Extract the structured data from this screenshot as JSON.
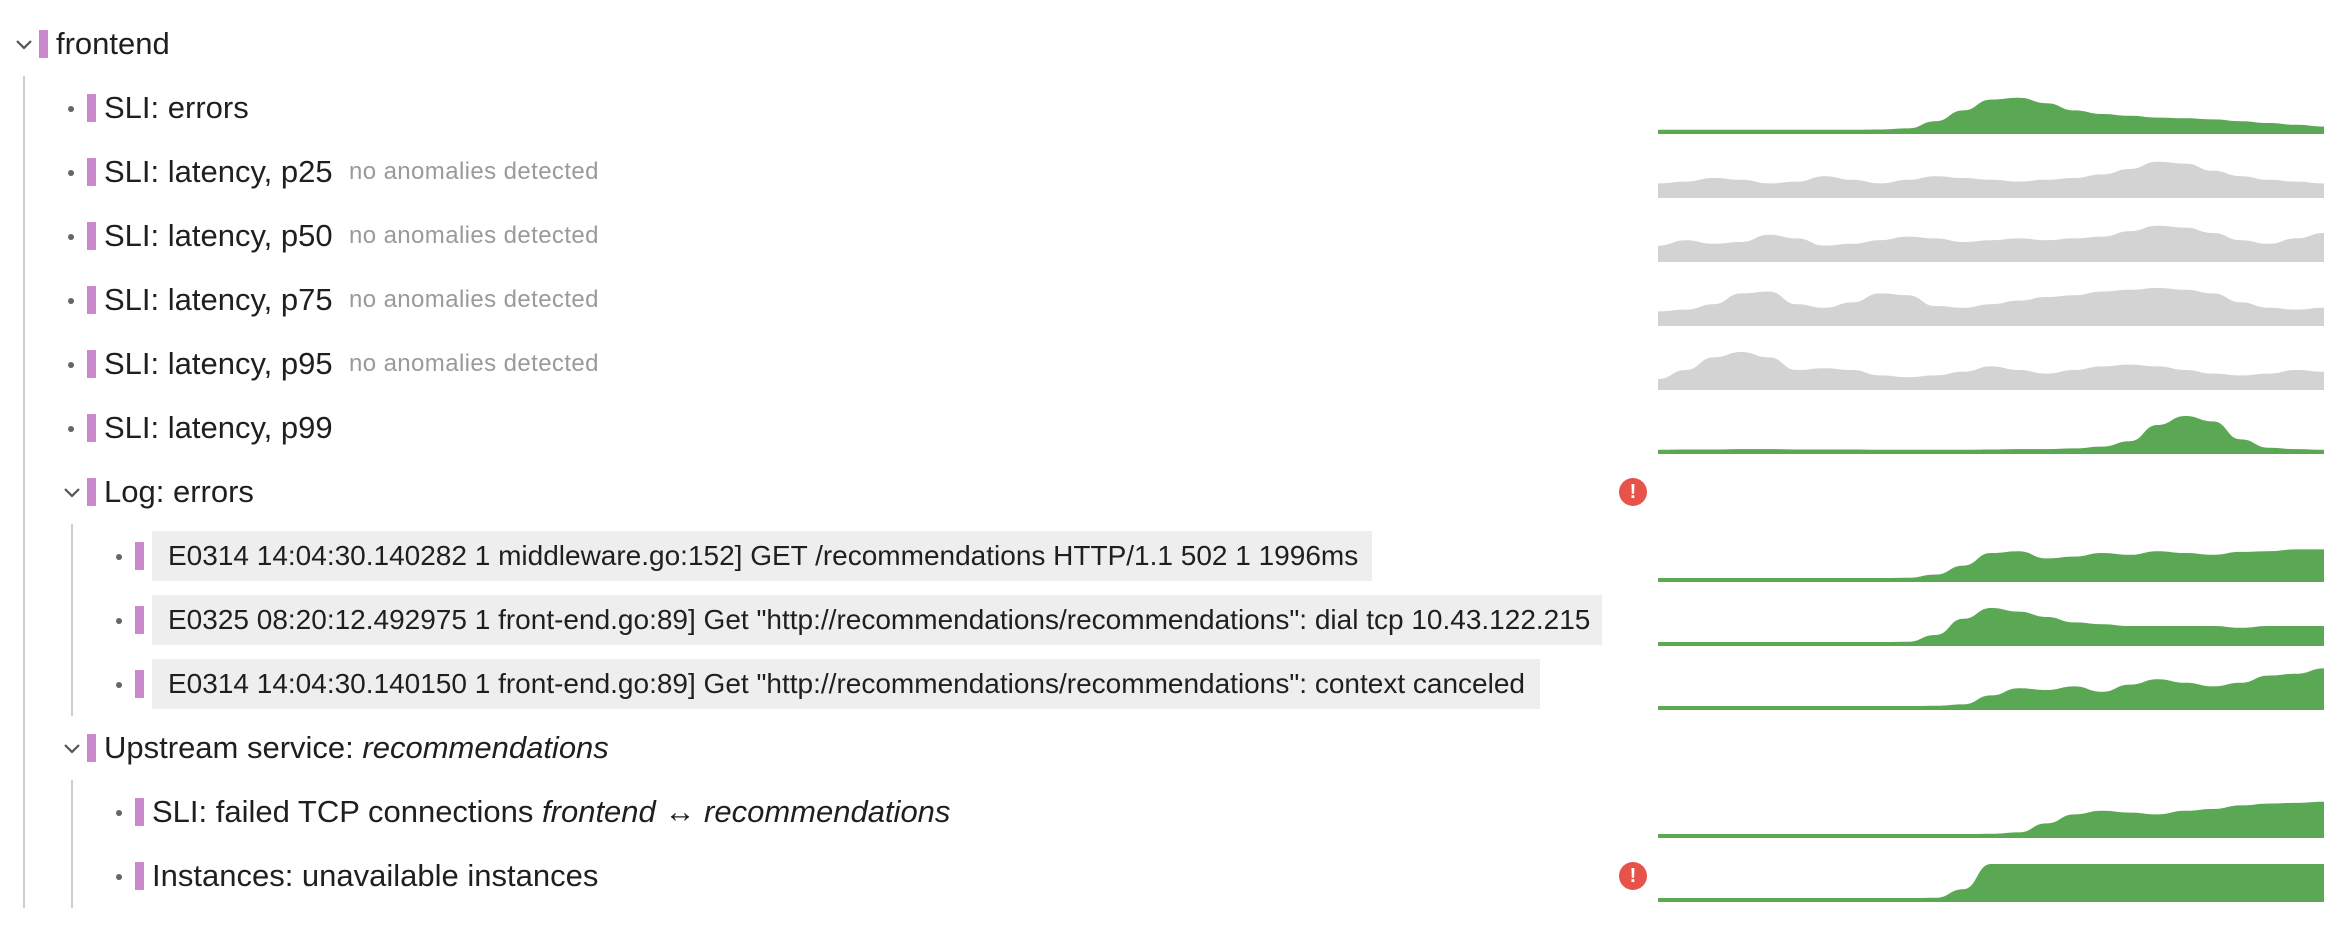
{
  "root": {
    "label": "frontend"
  },
  "rows": [
    {
      "label": "SLI: errors",
      "note": ""
    },
    {
      "label": "SLI: latency, p25",
      "note": "no anomalies detected"
    },
    {
      "label": "SLI: latency, p50",
      "note": "no anomalies detected"
    },
    {
      "label": "SLI: latency, p75",
      "note": "no anomalies detected"
    },
    {
      "label": "SLI: latency, p95",
      "note": "no anomalies detected"
    },
    {
      "label": "SLI: latency, p99",
      "note": ""
    }
  ],
  "log_group": {
    "label": "Log: errors",
    "status": "!",
    "entries": [
      "E0314 14:04:30.140282 1 middleware.go:152] GET /recommendations HTTP/1.1 502 1 1996ms",
      "E0325 08:20:12.492975 1 front-end.go:89] Get \"http://recommendations/recommendations\": dial tcp 10.43.122.215",
      "E0314 14:04:30.140150 1 front-end.go:89] Get \"http://recommendations/recommendations\": context canceled"
    ]
  },
  "upstream": {
    "prefix": "Upstream service: ",
    "service": "recommendations",
    "children": {
      "tcp": {
        "prefix": "SLI: failed TCP connections ",
        "from": "frontend",
        "arrow": " ↔ ",
        "to": "recommendations"
      },
      "instances": {
        "label": "Instances: unavailable instances",
        "status": "!"
      }
    }
  },
  "colors": {
    "anomaly": "#5aa854",
    "normal": "#d3d3d3",
    "marker": "#cc88cc",
    "alert": "#e5534b",
    "log_bg": "#eeeeee"
  },
  "icons": {
    "expand": "chevron-down-icon",
    "alert": "exclamation-circle-icon",
    "bullet": "bullet-icon"
  },
  "sparklines": [
    {
      "kind": "anomaly",
      "values": [
        0.06,
        0.06,
        0.06,
        0.06,
        0.06,
        0.06,
        0.06,
        0.06,
        0.07,
        0.1,
        0.3,
        0.6,
        0.9,
        0.95,
        0.8,
        0.6,
        0.5,
        0.45,
        0.4,
        0.38,
        0.35,
        0.3,
        0.25,
        0.2,
        0.15
      ]
    },
    {
      "kind": "normal",
      "values": [
        0.35,
        0.4,
        0.5,
        0.45,
        0.35,
        0.4,
        0.55,
        0.45,
        0.35,
        0.45,
        0.55,
        0.5,
        0.45,
        0.4,
        0.45,
        0.5,
        0.6,
        0.75,
        0.95,
        0.9,
        0.7,
        0.55,
        0.45,
        0.4,
        0.35
      ]
    },
    {
      "kind": "normal",
      "values": [
        0.4,
        0.55,
        0.45,
        0.5,
        0.7,
        0.6,
        0.4,
        0.45,
        0.55,
        0.65,
        0.6,
        0.5,
        0.55,
        0.6,
        0.55,
        0.6,
        0.65,
        0.8,
        0.95,
        0.9,
        0.75,
        0.55,
        0.45,
        0.6,
        0.75
      ]
    },
    {
      "kind": "normal",
      "values": [
        0.35,
        0.4,
        0.55,
        0.85,
        0.9,
        0.55,
        0.45,
        0.6,
        0.85,
        0.8,
        0.5,
        0.45,
        0.55,
        0.65,
        0.75,
        0.8,
        0.9,
        0.95,
        1.0,
        0.95,
        0.85,
        0.6,
        0.45,
        0.4,
        0.45
      ]
    },
    {
      "kind": "normal",
      "values": [
        0.25,
        0.5,
        0.85,
        1.0,
        0.85,
        0.5,
        0.55,
        0.5,
        0.35,
        0.3,
        0.35,
        0.45,
        0.6,
        0.5,
        0.4,
        0.5,
        0.6,
        0.65,
        0.6,
        0.5,
        0.4,
        0.35,
        0.4,
        0.5,
        0.45
      ]
    },
    {
      "kind": "anomaly",
      "values": [
        0.06,
        0.07,
        0.07,
        0.08,
        0.08,
        0.07,
        0.07,
        0.07,
        0.06,
        0.06,
        0.06,
        0.06,
        0.07,
        0.08,
        0.08,
        0.1,
        0.15,
        0.3,
        0.75,
        1.0,
        0.85,
        0.35,
        0.12,
        0.08,
        0.06
      ]
    },
    {
      "kind": "anomaly",
      "values": [
        0.05,
        0.05,
        0.05,
        0.05,
        0.05,
        0.05,
        0.05,
        0.05,
        0.05,
        0.06,
        0.15,
        0.4,
        0.75,
        0.8,
        0.6,
        0.65,
        0.75,
        0.7,
        0.8,
        0.75,
        0.7,
        0.78,
        0.8,
        0.85,
        0.85
      ]
    },
    {
      "kind": "anomaly",
      "values": [
        0.05,
        0.05,
        0.05,
        0.05,
        0.05,
        0.05,
        0.05,
        0.05,
        0.05,
        0.06,
        0.25,
        0.7,
        1.0,
        0.9,
        0.75,
        0.6,
        0.55,
        0.5,
        0.5,
        0.5,
        0.5,
        0.45,
        0.5,
        0.5,
        0.5
      ]
    },
    {
      "kind": "anomaly",
      "values": [
        0.05,
        0.05,
        0.05,
        0.05,
        0.05,
        0.05,
        0.05,
        0.05,
        0.05,
        0.05,
        0.06,
        0.1,
        0.35,
        0.55,
        0.5,
        0.6,
        0.45,
        0.65,
        0.8,
        0.7,
        0.6,
        0.7,
        0.9,
        0.95,
        1.1
      ]
    },
    {
      "kind": "anomaly",
      "values": [
        0.05,
        0.05,
        0.05,
        0.05,
        0.05,
        0.05,
        0.05,
        0.05,
        0.05,
        0.05,
        0.05,
        0.05,
        0.06,
        0.1,
        0.35,
        0.6,
        0.7,
        0.65,
        0.6,
        0.7,
        0.75,
        0.85,
        0.9,
        0.92,
        0.95
      ]
    },
    {
      "kind": "anomaly",
      "values": [
        0.05,
        0.05,
        0.05,
        0.05,
        0.05,
        0.05,
        0.05,
        0.05,
        0.05,
        0.05,
        0.06,
        0.3,
        1.0,
        1.0,
        1.0,
        1.0,
        1.0,
        1.0,
        1.0,
        1.0,
        1.0,
        1.0,
        1.0,
        1.0,
        1.0
      ]
    }
  ]
}
